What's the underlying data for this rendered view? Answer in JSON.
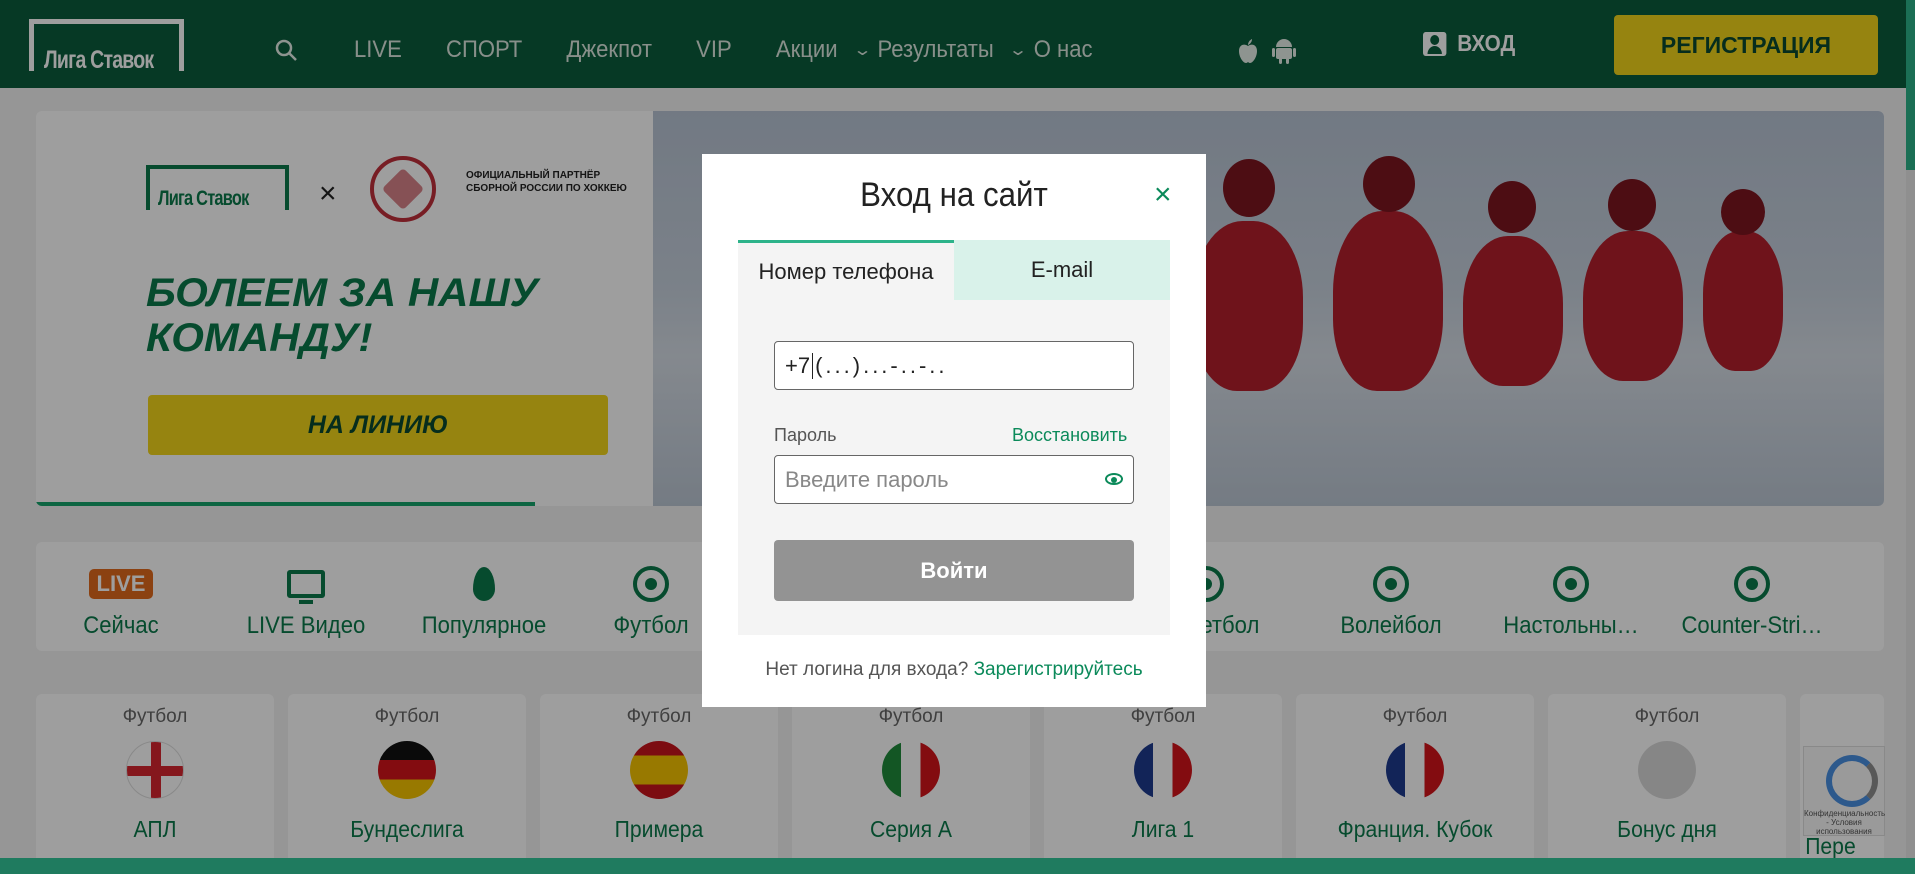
{
  "header": {
    "logo_text": "Лига Ставок",
    "nav": [
      "LIVE",
      "СПОРТ",
      "Джекпот",
      "VIP",
      "Акции",
      "Результаты",
      "О нас"
    ],
    "login_label": "ВХОД",
    "register_label": "РЕГИСТРАЦИЯ"
  },
  "banner": {
    "logo_text": "Лига Ставок",
    "partner_text": "ОФИЦИАЛЬНЫЙ ПАРТНЁР СБОРНОЙ РОССИИ ПО ХОККЕЮ",
    "slogan": "БОЛЕЕМ ЗА НАШУ КОМАНДУ!",
    "button_label": "НА ЛИНИЮ",
    "slide_progress": 0.27
  },
  "categories": [
    {
      "badge": "LIVE",
      "label": "Сейчас",
      "icon": "live-badge"
    },
    {
      "label": "LIVE Видео",
      "icon": "tv-icon"
    },
    {
      "label": "Популярное",
      "icon": "fire-icon"
    },
    {
      "label": "Футбол",
      "icon": "football-icon"
    },
    {
      "label": "Баскетбол",
      "icon": "basketball-icon"
    },
    {
      "label": "Волейбол",
      "icon": "volleyball-icon"
    },
    {
      "label": "Настольны…",
      "icon": "table-tennis-icon"
    },
    {
      "label": "Counter-Stri…",
      "icon": "counter-strike-icon"
    }
  ],
  "leagues": [
    {
      "sport": "Футбол",
      "name": "АПЛ",
      "flag": "england"
    },
    {
      "sport": "Футбол",
      "name": "Бундеслига",
      "flag": "germany"
    },
    {
      "sport": "Футбол",
      "name": "Примера",
      "flag": "spain"
    },
    {
      "sport": "Футбол",
      "name": "Серия А",
      "flag": "italy"
    },
    {
      "sport": "Футбол",
      "name": "Лига 1",
      "flag": "france"
    },
    {
      "sport": "Футбол",
      "name": "Франция. Кубок",
      "flag": "france"
    },
    {
      "sport": "Футбол",
      "name": "Бонус дня",
      "flag": "bonus"
    },
    {
      "sport": "",
      "name": "Пере",
      "flag": ""
    }
  ],
  "recaptcha_text": "Конфиденциальность - Условия использования",
  "modal": {
    "title": "Вход на сайт",
    "tab_phone": "Номер телефона",
    "tab_email": "E-mail",
    "phone_prefix": "+7",
    "phone_mask": "(...)...-..-..",
    "password_label": "Пароль",
    "restore_label": "Восстановить",
    "password_placeholder": "Введите пароль",
    "submit_label": "Войти",
    "footer_text": "Нет логина для входа?",
    "footer_link": "Зарегистрируйтесь"
  },
  "colors": {
    "brand_green": "#0b5c3c",
    "accent_yellow": "#f3d51a",
    "link_green": "#0b8a5a",
    "tab_active": "#2db38a"
  }
}
